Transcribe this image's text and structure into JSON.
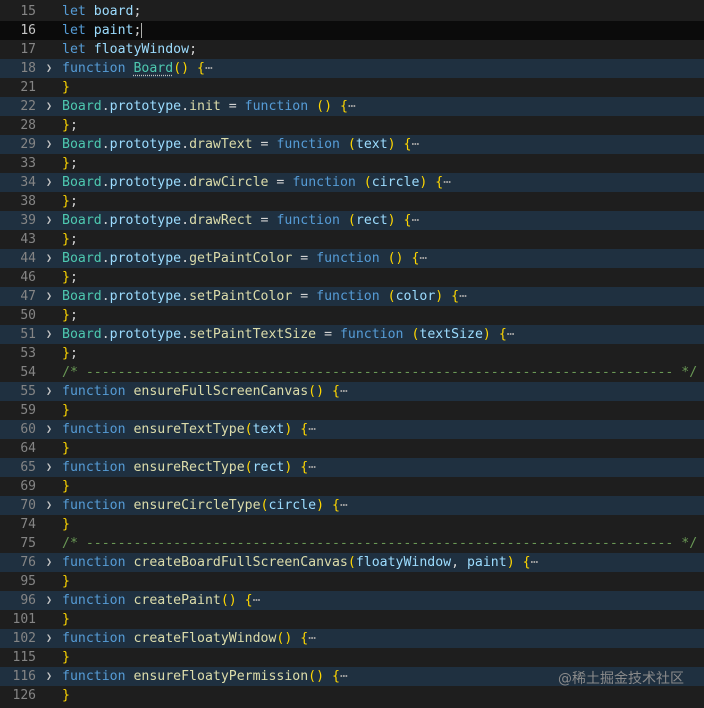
{
  "lines": [
    {
      "num": "15",
      "fold": false,
      "folded": false,
      "current": false,
      "tokens": [
        [
          "kw",
          "let"
        ],
        [
          "op",
          " "
        ],
        [
          "var",
          "board"
        ],
        [
          "op",
          ";"
        ]
      ]
    },
    {
      "num": "16",
      "fold": false,
      "folded": false,
      "current": true,
      "tokens": [
        [
          "kw",
          "let"
        ],
        [
          "op",
          " "
        ],
        [
          "var",
          "paint"
        ],
        [
          "op",
          ";"
        ]
      ]
    },
    {
      "num": "17",
      "fold": false,
      "folded": false,
      "current": false,
      "tokens": [
        [
          "kw",
          "let"
        ],
        [
          "op",
          " "
        ],
        [
          "var",
          "floatyWindow"
        ],
        [
          "op",
          ";"
        ]
      ]
    },
    {
      "num": "18",
      "fold": true,
      "folded": true,
      "current": false,
      "tokens": [
        [
          "kw",
          "function"
        ],
        [
          "op",
          " "
        ],
        [
          "cls u",
          "Board"
        ],
        [
          "br",
          "()"
        ],
        [
          "op",
          " "
        ],
        [
          "br",
          "{"
        ],
        [
          "ell",
          "⋯"
        ]
      ]
    },
    {
      "num": "21",
      "fold": false,
      "folded": false,
      "current": false,
      "tokens": [
        [
          "br",
          "}"
        ]
      ]
    },
    {
      "num": "22",
      "fold": true,
      "folded": true,
      "current": false,
      "tokens": [
        [
          "cls",
          "Board"
        ],
        [
          "op",
          "."
        ],
        [
          "var",
          "prototype"
        ],
        [
          "op",
          "."
        ],
        [
          "fn",
          "init"
        ],
        [
          "op",
          " = "
        ],
        [
          "kw",
          "function"
        ],
        [
          "op",
          " "
        ],
        [
          "br",
          "()"
        ],
        [
          "op",
          " "
        ],
        [
          "br",
          "{"
        ],
        [
          "ell",
          "⋯"
        ]
      ]
    },
    {
      "num": "28",
      "fold": false,
      "folded": false,
      "current": false,
      "tokens": [
        [
          "br",
          "}"
        ],
        [
          "op",
          ";"
        ]
      ]
    },
    {
      "num": "29",
      "fold": true,
      "folded": true,
      "current": false,
      "tokens": [
        [
          "cls",
          "Board"
        ],
        [
          "op",
          "."
        ],
        [
          "var",
          "prototype"
        ],
        [
          "op",
          "."
        ],
        [
          "fn",
          "drawText"
        ],
        [
          "op",
          " = "
        ],
        [
          "kw",
          "function"
        ],
        [
          "op",
          " "
        ],
        [
          "br",
          "("
        ],
        [
          "var",
          "text"
        ],
        [
          "br",
          ")"
        ],
        [
          "op",
          " "
        ],
        [
          "br",
          "{"
        ],
        [
          "ell",
          "⋯"
        ]
      ]
    },
    {
      "num": "33",
      "fold": false,
      "folded": false,
      "current": false,
      "tokens": [
        [
          "br",
          "}"
        ],
        [
          "op",
          ";"
        ]
      ]
    },
    {
      "num": "34",
      "fold": true,
      "folded": true,
      "current": false,
      "tokens": [
        [
          "cls",
          "Board"
        ],
        [
          "op",
          "."
        ],
        [
          "var",
          "prototype"
        ],
        [
          "op",
          "."
        ],
        [
          "fn",
          "drawCircle"
        ],
        [
          "op",
          " = "
        ],
        [
          "kw",
          "function"
        ],
        [
          "op",
          " "
        ],
        [
          "br",
          "("
        ],
        [
          "var",
          "circle"
        ],
        [
          "br",
          ")"
        ],
        [
          "op",
          " "
        ],
        [
          "br",
          "{"
        ],
        [
          "ell",
          "⋯"
        ]
      ]
    },
    {
      "num": "38",
      "fold": false,
      "folded": false,
      "current": false,
      "tokens": [
        [
          "br",
          "}"
        ],
        [
          "op",
          ";"
        ]
      ]
    },
    {
      "num": "39",
      "fold": true,
      "folded": true,
      "current": false,
      "tokens": [
        [
          "cls",
          "Board"
        ],
        [
          "op",
          "."
        ],
        [
          "var",
          "prototype"
        ],
        [
          "op",
          "."
        ],
        [
          "fn",
          "drawRect"
        ],
        [
          "op",
          " = "
        ],
        [
          "kw",
          "function"
        ],
        [
          "op",
          " "
        ],
        [
          "br",
          "("
        ],
        [
          "var",
          "rect"
        ],
        [
          "br",
          ")"
        ],
        [
          "op",
          " "
        ],
        [
          "br",
          "{"
        ],
        [
          "ell",
          "⋯"
        ]
      ]
    },
    {
      "num": "43",
      "fold": false,
      "folded": false,
      "current": false,
      "tokens": [
        [
          "br",
          "}"
        ],
        [
          "op",
          ";"
        ]
      ]
    },
    {
      "num": "44",
      "fold": true,
      "folded": true,
      "current": false,
      "tokens": [
        [
          "cls",
          "Board"
        ],
        [
          "op",
          "."
        ],
        [
          "var",
          "prototype"
        ],
        [
          "op",
          "."
        ],
        [
          "fn",
          "getPaintColor"
        ],
        [
          "op",
          " = "
        ],
        [
          "kw",
          "function"
        ],
        [
          "op",
          " "
        ],
        [
          "br",
          "()"
        ],
        [
          "op",
          " "
        ],
        [
          "br",
          "{"
        ],
        [
          "ell",
          "⋯"
        ]
      ]
    },
    {
      "num": "46",
      "fold": false,
      "folded": false,
      "current": false,
      "tokens": [
        [
          "br",
          "}"
        ],
        [
          "op",
          ";"
        ]
      ]
    },
    {
      "num": "47",
      "fold": true,
      "folded": true,
      "current": false,
      "tokens": [
        [
          "cls",
          "Board"
        ],
        [
          "op",
          "."
        ],
        [
          "var",
          "prototype"
        ],
        [
          "op",
          "."
        ],
        [
          "fn",
          "setPaintColor"
        ],
        [
          "op",
          " = "
        ],
        [
          "kw",
          "function"
        ],
        [
          "op",
          " "
        ],
        [
          "br",
          "("
        ],
        [
          "var",
          "color"
        ],
        [
          "br",
          ")"
        ],
        [
          "op",
          " "
        ],
        [
          "br",
          "{"
        ],
        [
          "ell",
          "⋯"
        ]
      ]
    },
    {
      "num": "50",
      "fold": false,
      "folded": false,
      "current": false,
      "tokens": [
        [
          "br",
          "}"
        ],
        [
          "op",
          ";"
        ]
      ]
    },
    {
      "num": "51",
      "fold": true,
      "folded": true,
      "current": false,
      "tokens": [
        [
          "cls",
          "Board"
        ],
        [
          "op",
          "."
        ],
        [
          "var",
          "prototype"
        ],
        [
          "op",
          "."
        ],
        [
          "fn",
          "setPaintTextSize"
        ],
        [
          "op",
          " = "
        ],
        [
          "kw",
          "function"
        ],
        [
          "op",
          " "
        ],
        [
          "br",
          "("
        ],
        [
          "var",
          "textSize"
        ],
        [
          "br",
          ")"
        ],
        [
          "op",
          " "
        ],
        [
          "br",
          "{"
        ],
        [
          "ell",
          "⋯"
        ]
      ]
    },
    {
      "num": "53",
      "fold": false,
      "folded": false,
      "current": false,
      "tokens": [
        [
          "br",
          "}"
        ],
        [
          "op",
          ";"
        ]
      ]
    },
    {
      "num": "54",
      "fold": false,
      "folded": false,
      "current": false,
      "tokens": [
        [
          "cm",
          "/* -------------------------------------------------------------------------- */"
        ]
      ]
    },
    {
      "num": "55",
      "fold": true,
      "folded": true,
      "current": false,
      "tokens": [
        [
          "kw",
          "function"
        ],
        [
          "op",
          " "
        ],
        [
          "fn",
          "ensureFullScreenCanvas"
        ],
        [
          "br",
          "()"
        ],
        [
          "op",
          " "
        ],
        [
          "br",
          "{"
        ],
        [
          "ell",
          "⋯"
        ]
      ]
    },
    {
      "num": "59",
      "fold": false,
      "folded": false,
      "current": false,
      "tokens": [
        [
          "br",
          "}"
        ]
      ]
    },
    {
      "num": "60",
      "fold": true,
      "folded": true,
      "current": false,
      "tokens": [
        [
          "kw",
          "function"
        ],
        [
          "op",
          " "
        ],
        [
          "fn",
          "ensureTextType"
        ],
        [
          "br",
          "("
        ],
        [
          "var",
          "text"
        ],
        [
          "br",
          ")"
        ],
        [
          "op",
          " "
        ],
        [
          "br",
          "{"
        ],
        [
          "ell",
          "⋯"
        ]
      ]
    },
    {
      "num": "64",
      "fold": false,
      "folded": false,
      "current": false,
      "tokens": [
        [
          "br",
          "}"
        ]
      ]
    },
    {
      "num": "65",
      "fold": true,
      "folded": true,
      "current": false,
      "tokens": [
        [
          "kw",
          "function"
        ],
        [
          "op",
          " "
        ],
        [
          "fn",
          "ensureRectType"
        ],
        [
          "br",
          "("
        ],
        [
          "var",
          "rect"
        ],
        [
          "br",
          ")"
        ],
        [
          "op",
          " "
        ],
        [
          "br",
          "{"
        ],
        [
          "ell",
          "⋯"
        ]
      ]
    },
    {
      "num": "69",
      "fold": false,
      "folded": false,
      "current": false,
      "tokens": [
        [
          "br",
          "}"
        ]
      ]
    },
    {
      "num": "70",
      "fold": true,
      "folded": true,
      "current": false,
      "tokens": [
        [
          "kw",
          "function"
        ],
        [
          "op",
          " "
        ],
        [
          "fn",
          "ensureCircleType"
        ],
        [
          "br",
          "("
        ],
        [
          "var",
          "circle"
        ],
        [
          "br",
          ")"
        ],
        [
          "op",
          " "
        ],
        [
          "br",
          "{"
        ],
        [
          "ell",
          "⋯"
        ]
      ]
    },
    {
      "num": "74",
      "fold": false,
      "folded": false,
      "current": false,
      "tokens": [
        [
          "br",
          "}"
        ]
      ]
    },
    {
      "num": "75",
      "fold": false,
      "folded": false,
      "current": false,
      "tokens": [
        [
          "cm",
          "/* -------------------------------------------------------------------------- */"
        ]
      ]
    },
    {
      "num": "76",
      "fold": true,
      "folded": true,
      "current": false,
      "tokens": [
        [
          "kw",
          "function"
        ],
        [
          "op",
          " "
        ],
        [
          "fn",
          "createBoardFullScreenCanvas"
        ],
        [
          "br",
          "("
        ],
        [
          "var",
          "floatyWindow"
        ],
        [
          "op",
          ", "
        ],
        [
          "var",
          "paint"
        ],
        [
          "br",
          ")"
        ],
        [
          "op",
          " "
        ],
        [
          "br",
          "{"
        ],
        [
          "ell",
          "⋯"
        ]
      ]
    },
    {
      "num": "95",
      "fold": false,
      "folded": false,
      "current": false,
      "tokens": [
        [
          "br",
          "}"
        ]
      ]
    },
    {
      "num": "96",
      "fold": true,
      "folded": true,
      "current": false,
      "tokens": [
        [
          "kw",
          "function"
        ],
        [
          "op",
          " "
        ],
        [
          "fn",
          "createPaint"
        ],
        [
          "br",
          "()"
        ],
        [
          "op",
          " "
        ],
        [
          "br",
          "{"
        ],
        [
          "ell",
          "⋯"
        ]
      ]
    },
    {
      "num": "101",
      "fold": false,
      "folded": false,
      "current": false,
      "tokens": [
        [
          "br",
          "}"
        ]
      ]
    },
    {
      "num": "102",
      "fold": true,
      "folded": true,
      "current": false,
      "tokens": [
        [
          "kw",
          "function"
        ],
        [
          "op",
          " "
        ],
        [
          "fn",
          "createFloatyWindow"
        ],
        [
          "br",
          "()"
        ],
        [
          "op",
          " "
        ],
        [
          "br",
          "{"
        ],
        [
          "ell",
          "⋯"
        ]
      ]
    },
    {
      "num": "115",
      "fold": false,
      "folded": false,
      "current": false,
      "tokens": [
        [
          "br",
          "}"
        ]
      ]
    },
    {
      "num": "116",
      "fold": true,
      "folded": true,
      "current": false,
      "tokens": [
        [
          "kw",
          "function"
        ],
        [
          "op",
          " "
        ],
        [
          "fn",
          "ensureFloatyPermission"
        ],
        [
          "br",
          "()"
        ],
        [
          "op",
          " "
        ],
        [
          "br",
          "{"
        ],
        [
          "ell",
          "⋯"
        ]
      ]
    },
    {
      "num": "126",
      "fold": false,
      "folded": false,
      "current": false,
      "tokens": [
        [
          "br",
          "}"
        ]
      ]
    }
  ],
  "watermark": "@稀土掘金技术社区",
  "fold_icon": "chevron-right-icon",
  "colors": {
    "background": "#1e1e1e",
    "keyword": "#569cd6",
    "variable": "#9cdcfe",
    "class": "#4ec9b0",
    "function": "#dcdcaa",
    "bracket": "#ffd700",
    "comment": "#6a9955"
  }
}
